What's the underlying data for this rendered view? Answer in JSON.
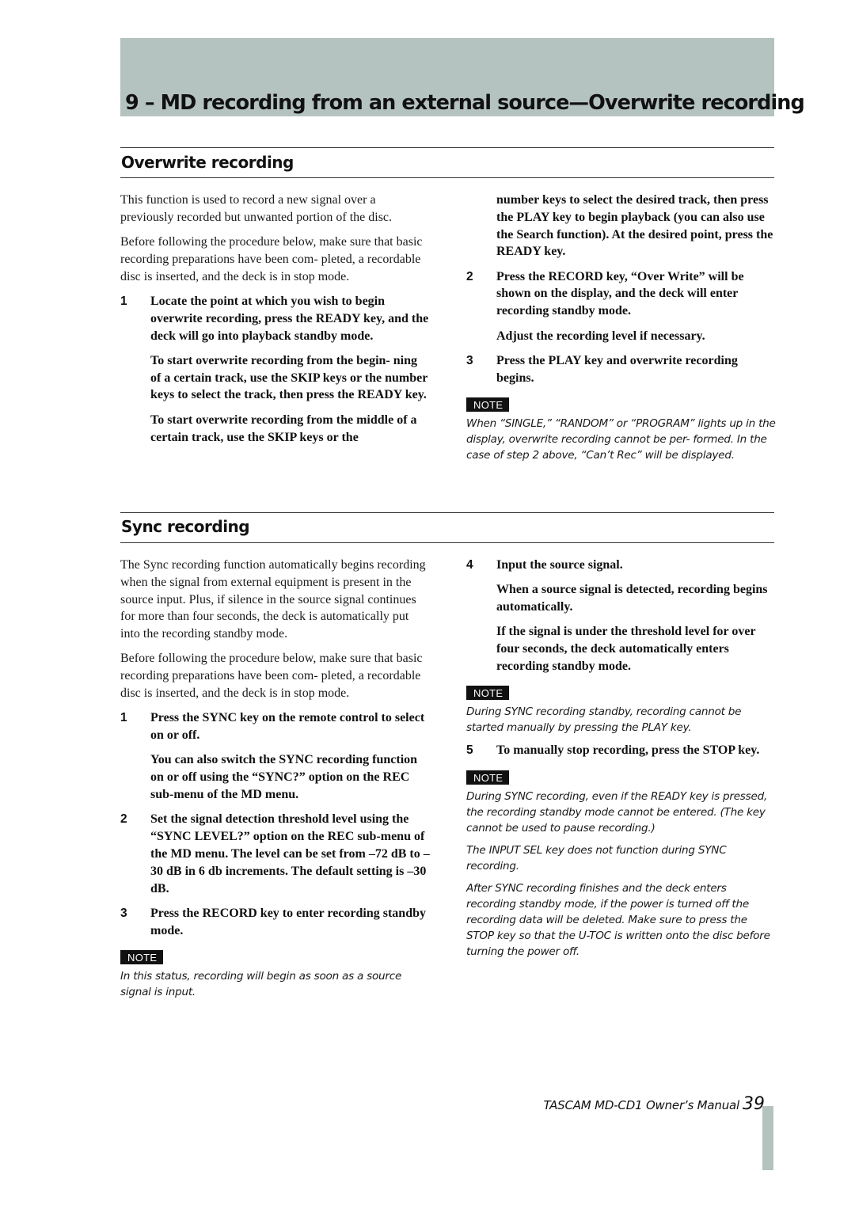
{
  "chapter": {
    "title": "9 – MD recording from an external source—Overwrite recording"
  },
  "overwrite": {
    "title": "Overwrite recording",
    "intro": [
      "This function is used to record a new signal over a previously recorded but unwanted portion of the disc.",
      "Before following the procedure below, make sure that basic recording preparations have been com- pleted, a recordable disc is inserted, and the deck is in stop mode."
    ],
    "steps": [
      {
        "number": "1",
        "text": "Locate the point at which you wish to begin overwrite recording, press the READY key, and the deck will go into playback standby mode.",
        "sub": [
          "To start overwrite recording from the begin- ning of a certain track, use the SKIP keys or the number keys to select the track, then press the READY key.",
          "To start overwrite recording from the middle of a certain track, use the SKIP keys or the number keys to select the desired track, then press the PLAY key to begin playback (you can also use the Search function). At the desired point, press the READY key."
        ]
      },
      {
        "number": "2",
        "text": "Press the RECORD key, “Over Write” will be shown on the display, and the deck will enter recording standby mode.",
        "sub": [
          "Adjust the recording level if necessary."
        ]
      },
      {
        "number": "3",
        "text": "Press the PLAY key and overwrite recording begins.",
        "sub": []
      }
    ],
    "note_label": "NOTE",
    "note": "When “SINGLE,” “RANDOM” or “PROGRAM” lights up in the display, overwrite recording cannot be per- formed. In the case of step 2 above, “Can’t Rec” will be displayed."
  },
  "sync": {
    "title": "Sync recording",
    "intro": [
      "The Sync recording function automatically begins recording when the signal from external equipment is present in the source input. Plus, if silence in the source signal continues for more than four seconds, the deck is automatically put into the recording standby mode.",
      "Before following the procedure below, make sure that basic recording preparations have been com- pleted, a recordable disc is inserted, and the deck is in stop mode."
    ],
    "steps": [
      {
        "number": "1",
        "text": "Press the SYNC key on the remote control to select on or off.",
        "sub": [
          "You can also switch the SYNC recording function on or off using the “SYNC?” option on the REC sub-menu of the MD menu."
        ]
      },
      {
        "number": "2",
        "text": "Set the signal detection threshold level using the “SYNC LEVEL?” option on the REC sub-menu of the MD menu. The level can be set from –72 dB to –30 dB in 6 db increments. The default setting is –30 dB.",
        "sub": []
      },
      {
        "number": "3",
        "text": "Press the RECORD key to enter recording standby mode.",
        "sub": []
      },
      {
        "number": "4",
        "text": "Input the source signal.",
        "sub": [
          "When a source signal is detected, recording begins automatically.",
          "If the signal is under the threshold level for over four seconds, the deck automatically enters recording standby mode."
        ]
      },
      {
        "number": "5",
        "text": "To manually stop recording, press the STOP key.",
        "sub": []
      }
    ],
    "note_label": "NOTE",
    "notes": [
      "In this status, recording will begin as soon as a source signal is input.",
      "During SYNC recording standby, recording cannot be started manually by pressing the PLAY key.",
      "During SYNC recording, even if the READY key is pressed, the recording standby mode cannot be entered. (The key cannot be used to pause recording.)",
      "The INPUT SEL key does not function during SYNC recording.",
      "After SYNC recording finishes and the deck enters recording standby mode, if the power is turned off the recording data will be deleted. Make sure to press the STOP key so that the U-TOC is written onto the disc before turning the power off."
    ]
  },
  "footer": {
    "manual": "TASCAM MD-CD1 Owner’s Manual",
    "page": "39"
  },
  "split_text": {
    "ow_step1_sub2_left": "To start overwrite recording from the middle of a certain track, use the SKIP keys or the",
    "ow_step1_sub2_right": "number keys to select the desired track, then press the PLAY key to begin playback (you can also use the Search function). At the desired point, press the READY key."
  }
}
